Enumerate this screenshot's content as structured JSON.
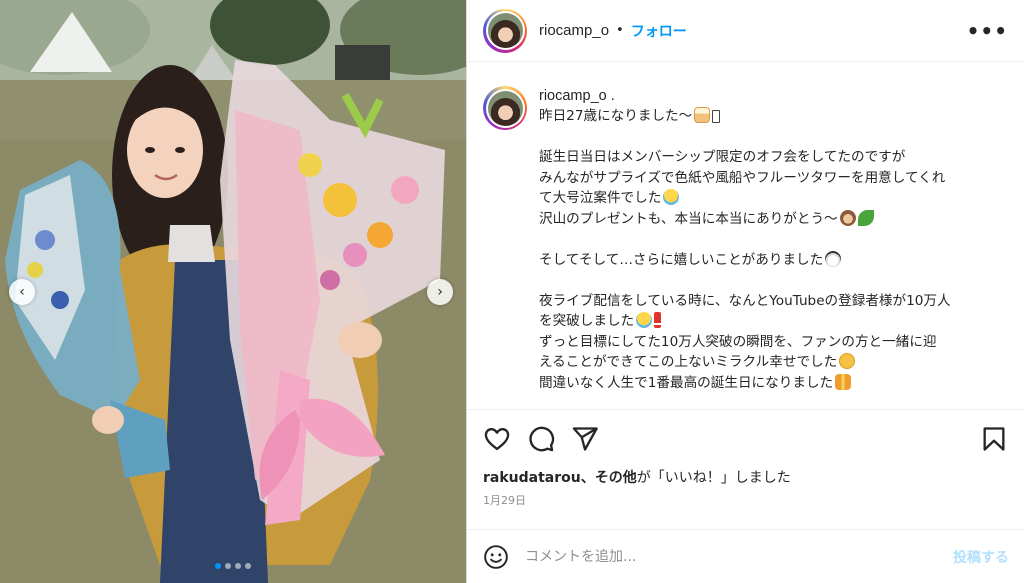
{
  "post": {
    "username": "riocamp_o",
    "separator": "•",
    "follow_label": "フォロー",
    "more_icon": "•••",
    "caption": {
      "username": "riocamp_o .",
      "lines": [
        "昨日27歳になりました〜",
        "",
        "誕生日当日はメンバーシップ限定のオフ会をしてたのですが",
        "みんながサプライズで色紙や風船やフルーツタワーを用意してくれ",
        "て大号泣案件でした",
        "沢山のプレゼントも、本当に本当にありがとう〜",
        "",
        "そしてそして…さらに嬉しいことがありました",
        "",
        "夜ライブ配信をしている時に、なんとYouTubeの登録者様が10万人",
        "を突破しました",
        "ずっと目標にしてた10万人突破の瞬間を、ファンの方と一緒に迎",
        "えることができてこの上ないミラクル幸せでした",
        "間違いなく人生で1番最高の誕生日になりました"
      ]
    },
    "likes": {
      "user": "rakudatarou",
      "others": "、その他",
      "suffix": "が「いいね！」しました"
    },
    "date": "1月29日",
    "comment": {
      "placeholder": "コメントを追加...",
      "post_label": "投稿する"
    },
    "carousel": {
      "prev_icon": "‹",
      "next_icon": "›",
      "total_images": 4,
      "active_index": 0
    }
  },
  "colors": {
    "accent": "#0095f6",
    "post_button_disabled": "#b2dffc",
    "muted_text": "#8e8e8e"
  },
  "icons": [
    "heart-icon",
    "comment-icon",
    "share-icon",
    "bookmark-icon",
    "emoji-icon",
    "more-icon"
  ]
}
